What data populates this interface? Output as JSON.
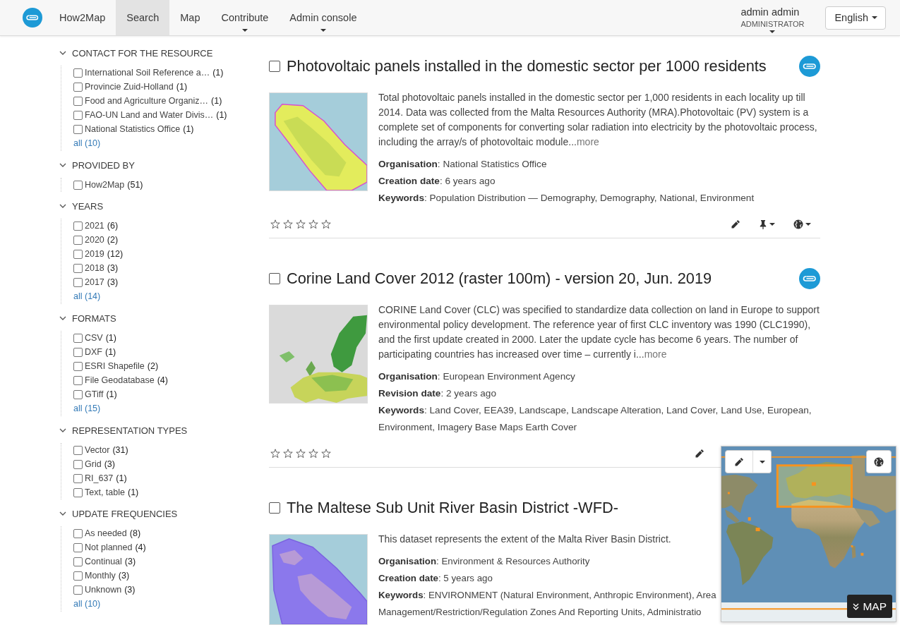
{
  "navbar": {
    "items": [
      {
        "label": "How2Map",
        "selected": false,
        "has_menu": false
      },
      {
        "label": "Search",
        "selected": true,
        "has_menu": false
      },
      {
        "label": "Map",
        "selected": false,
        "has_menu": false
      },
      {
        "label": "Contribute",
        "selected": false,
        "has_menu": true
      },
      {
        "label": "Admin console",
        "selected": false,
        "has_menu": true
      }
    ],
    "user": {
      "name": "admin admin",
      "role": "ADMINISTRATOR"
    },
    "language": "English"
  },
  "facets": [
    {
      "title": "CONTACT FOR THE RESOURCE",
      "expanded": true,
      "items": [
        {
          "label": "International Soil Reference a…",
          "count": "(1)",
          "checked": false
        },
        {
          "label": "Provincie Zuid-Holland",
          "count": "(1)",
          "checked": false
        },
        {
          "label": "Food and Agriculture Organiz…",
          "count": "(1)",
          "checked": false
        },
        {
          "label": "FAO-UN Land and Water Divis…",
          "count": "(1)",
          "checked": false
        },
        {
          "label": "National Statistics Office",
          "count": "(1)",
          "checked": false
        }
      ],
      "more": "all (10)"
    },
    {
      "title": "PROVIDED BY",
      "expanded": true,
      "items": [
        {
          "label": "How2Map",
          "count": "(51)",
          "checked": false
        }
      ]
    },
    {
      "title": "YEARS",
      "expanded": true,
      "items": [
        {
          "label": "2021",
          "count": "(6)",
          "checked": false
        },
        {
          "label": "2020",
          "count": "(2)",
          "checked": false
        },
        {
          "label": "2019",
          "count": "(12)",
          "checked": false
        },
        {
          "label": "2018",
          "count": "(3)",
          "checked": false
        },
        {
          "label": "2017",
          "count": "(3)",
          "checked": false
        }
      ],
      "more": "all (14)"
    },
    {
      "title": "FORMATS",
      "expanded": true,
      "items": [
        {
          "label": "CSV",
          "count": "(1)",
          "checked": false
        },
        {
          "label": "DXF",
          "count": "(1)",
          "checked": false
        },
        {
          "label": "ESRI Shapefile",
          "count": "(2)",
          "checked": false
        },
        {
          "label": "File Geodatabase",
          "count": "(4)",
          "checked": false
        },
        {
          "label": "GTiff",
          "count": "(1)",
          "checked": false
        }
      ],
      "more": "all (15)"
    },
    {
      "title": "REPRESENTATION TYPES",
      "expanded": true,
      "items": [
        {
          "label": "Vector",
          "count": "(31)",
          "checked": false
        },
        {
          "label": "Grid",
          "count": "(3)",
          "checked": false
        },
        {
          "label": "RI_637",
          "count": "(1)",
          "checked": false
        },
        {
          "label": "Text, table",
          "count": "(1)",
          "checked": false
        }
      ]
    },
    {
      "title": "UPDATE FREQUENCIES",
      "expanded": true,
      "items": [
        {
          "label": "As needed",
          "count": "(8)",
          "checked": false
        },
        {
          "label": "Not planned",
          "count": "(4)",
          "checked": false
        },
        {
          "label": "Continual",
          "count": "(3)",
          "checked": false
        },
        {
          "label": "Monthly",
          "count": "(3)",
          "checked": false
        },
        {
          "label": "Unknown",
          "count": "(3)",
          "checked": false
        }
      ],
      "more": "all (10)"
    }
  ],
  "results": [
    {
      "title": "Photovoltaic panels installed in the domestic sector per 1000 residents",
      "checked": false,
      "source_logo": true,
      "description": "Total photovoltaic panels installed in the domestic sector per 1,000 residents in each locality up till 2014. Data was collected from the Malta Resources Authority (MRA).Photovoltaic (PV) system is a complete set of components for converting solar radiation into electricity by the photovoltaic process, including the array/s of photovoltaic module...",
      "more": "more",
      "meta": [
        "**Organisation**: National Statistics Office",
        "**Creation date**: 6 years ago",
        "**Keywords**: Population Distribution — Demography, Demography, National, Environment"
      ],
      "stars": 0,
      "actions": [
        {
          "kind": "edit",
          "menu": false
        },
        {
          "kind": "pin",
          "menu": true
        },
        {
          "kind": "globe",
          "menu": true
        }
      ]
    },
    {
      "title": "Corine Land Cover 2012 (raster 100m) - version 20, Jun. 2019",
      "checked": false,
      "source_logo": true,
      "description": "CORINE Land Cover (CLC) was specified to standardize data collection on land in Europe to support environmental policy development. The reference year of first CLC inventory was 1990 (CLC1990), and the first update created in 2000. Later the update cycle has become 6 years. The number of participating countries has increased over time – currently i...",
      "more": "more",
      "meta": [
        "**Organisation**: European Environment Agency",
        "**Revision date**: 2 years ago",
        "**Keywords**: Land Cover, EEA39, Landscape, Landscape Alteration, Land Cover, Land Use, European, Environment, Imagery Base Maps Earth Cover"
      ],
      "stars": 0,
      "actions": [
        {
          "kind": "edit",
          "menu": false
        }
      ]
    },
    {
      "title": "The Maltese Sub Unit River Basin District -WFD-",
      "checked": false,
      "description": "This dataset represents the extent of the Malta River Basin District.",
      "meta": [
        "**Organisation**: Environment & Resources Authority",
        "**Creation date**: 5 years ago",
        "**Keywords**: ENVIRONMENT (Natural Environment, Anthropic Environment), Area Management/Restriction/Regulation Zones And Reporting Units, Administratio"
      ]
    }
  ],
  "map_panel": {
    "toggle_label": "MAP"
  }
}
